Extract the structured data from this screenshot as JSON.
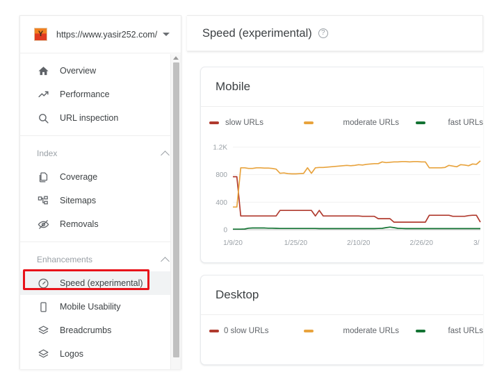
{
  "property": {
    "favicon_letter": "Y",
    "url": "https://www.yasir252.com/",
    "dropdown_icon": "chevron-down-icon"
  },
  "sidebar": {
    "top_items": [
      {
        "label": "Overview",
        "icon": "home-icon"
      },
      {
        "label": "Performance",
        "icon": "trending-up-icon"
      },
      {
        "label": "URL inspection",
        "icon": "search-icon"
      }
    ],
    "sections": [
      {
        "title": "Index",
        "collapse_icon": "chevron-up-icon",
        "items": [
          {
            "label": "Coverage",
            "icon": "pages-icon"
          },
          {
            "label": "Sitemaps",
            "icon": "sitemap-icon"
          },
          {
            "label": "Removals",
            "icon": "eye-off-icon"
          }
        ]
      },
      {
        "title": "Enhancements",
        "collapse_icon": "chevron-up-icon",
        "items": [
          {
            "label": "Speed (experimental)",
            "icon": "speedometer-icon",
            "selected": true
          },
          {
            "label": "Mobile Usability",
            "icon": "phone-icon"
          },
          {
            "label": "Breadcrumbs",
            "icon": "layers-icon"
          },
          {
            "label": "Logos",
            "icon": "layers-icon"
          }
        ]
      }
    ],
    "scrollbar": {
      "arrow_icon": "scroll-up-arrow-icon"
    }
  },
  "annotation": {
    "color": "#e8131a",
    "target": "Speed (experimental)"
  },
  "header": {
    "title": "Speed (experimental)",
    "help_icon": "help-circle-icon",
    "help_glyph": "?"
  },
  "colors": {
    "slow": "#b03a2e",
    "moderate": "#e8a33d",
    "fast": "#137333",
    "grid": "#f0f0f0",
    "axis_text": "#9aa0a6"
  },
  "cards": [
    {
      "id": "mobile",
      "title": "Mobile",
      "legend": [
        {
          "label": "slow URLs",
          "color": "#b03a2e"
        },
        {
          "label": "moderate URLs",
          "color": "#e8a33d"
        },
        {
          "label": "fast URLs",
          "color": "#137333"
        }
      ]
    },
    {
      "id": "desktop",
      "title": "Desktop",
      "legend": [
        {
          "label": "0 slow URLs",
          "color": "#b03a2e"
        },
        {
          "label": "moderate URLs",
          "color": "#e8a33d"
        },
        {
          "label": "fast URLs",
          "color": "#137333"
        }
      ]
    }
  ],
  "chart_data": {
    "type": "line",
    "title": "Mobile",
    "xlabel": "",
    "ylabel": "",
    "ylim": [
      0,
      1200
    ],
    "yticks": [
      0,
      400,
      800,
      1200
    ],
    "ytick_labels": [
      "0",
      "400",
      "800",
      "1.2K"
    ],
    "grid": true,
    "legend_position": "top",
    "xtick_labels": [
      "1/9/20",
      "1/25/20",
      "2/10/20",
      "2/26/20",
      "3/"
    ],
    "xtick_positions": [
      0,
      16,
      32,
      48,
      62
    ],
    "x_count": 64,
    "series": [
      {
        "name": "slow URLs",
        "color": "#b03a2e",
        "values": [
          770,
          770,
          200,
          200,
          200,
          200,
          200,
          200,
          200,
          200,
          200,
          200,
          280,
          280,
          280,
          280,
          280,
          280,
          280,
          280,
          280,
          200,
          280,
          200,
          200,
          200,
          200,
          200,
          200,
          200,
          200,
          200,
          200,
          195,
          195,
          195,
          195,
          160,
          160,
          160,
          160,
          110,
          110,
          110,
          110,
          110,
          110,
          110,
          110,
          110,
          210,
          210,
          210,
          210,
          210,
          210,
          195,
          195,
          195,
          195,
          205,
          210,
          210,
          110
        ]
      },
      {
        "name": "moderate URLs",
        "color": "#e8a33d",
        "values": [
          330,
          330,
          900,
          900,
          890,
          890,
          900,
          900,
          895,
          895,
          890,
          880,
          820,
          825,
          815,
          812,
          812,
          815,
          818,
          900,
          820,
          900,
          905,
          905,
          910,
          915,
          920,
          925,
          930,
          935,
          930,
          935,
          945,
          940,
          950,
          955,
          960,
          960,
          985,
          975,
          980,
          985,
          985,
          990,
          990,
          985,
          990,
          990,
          985,
          985,
          900,
          900,
          900,
          900,
          905,
          935,
          925,
          915,
          945,
          940,
          930,
          955,
          950,
          1000
        ]
      },
      {
        "name": "fast URLs",
        "color": "#137333",
        "values": [
          8,
          8,
          8,
          10,
          22,
          25,
          25,
          25,
          25,
          22,
          22,
          20,
          18,
          18,
          18,
          18,
          18,
          18,
          18,
          18,
          18,
          18,
          16,
          16,
          16,
          16,
          16,
          16,
          16,
          16,
          16,
          16,
          16,
          16,
          16,
          16,
          16,
          18,
          20,
          30,
          38,
          30,
          20,
          18,
          16,
          16,
          16,
          16,
          16,
          16,
          16,
          16,
          16,
          16,
          16,
          16,
          16,
          16,
          16,
          16,
          16,
          16,
          16,
          16
        ]
      }
    ]
  }
}
